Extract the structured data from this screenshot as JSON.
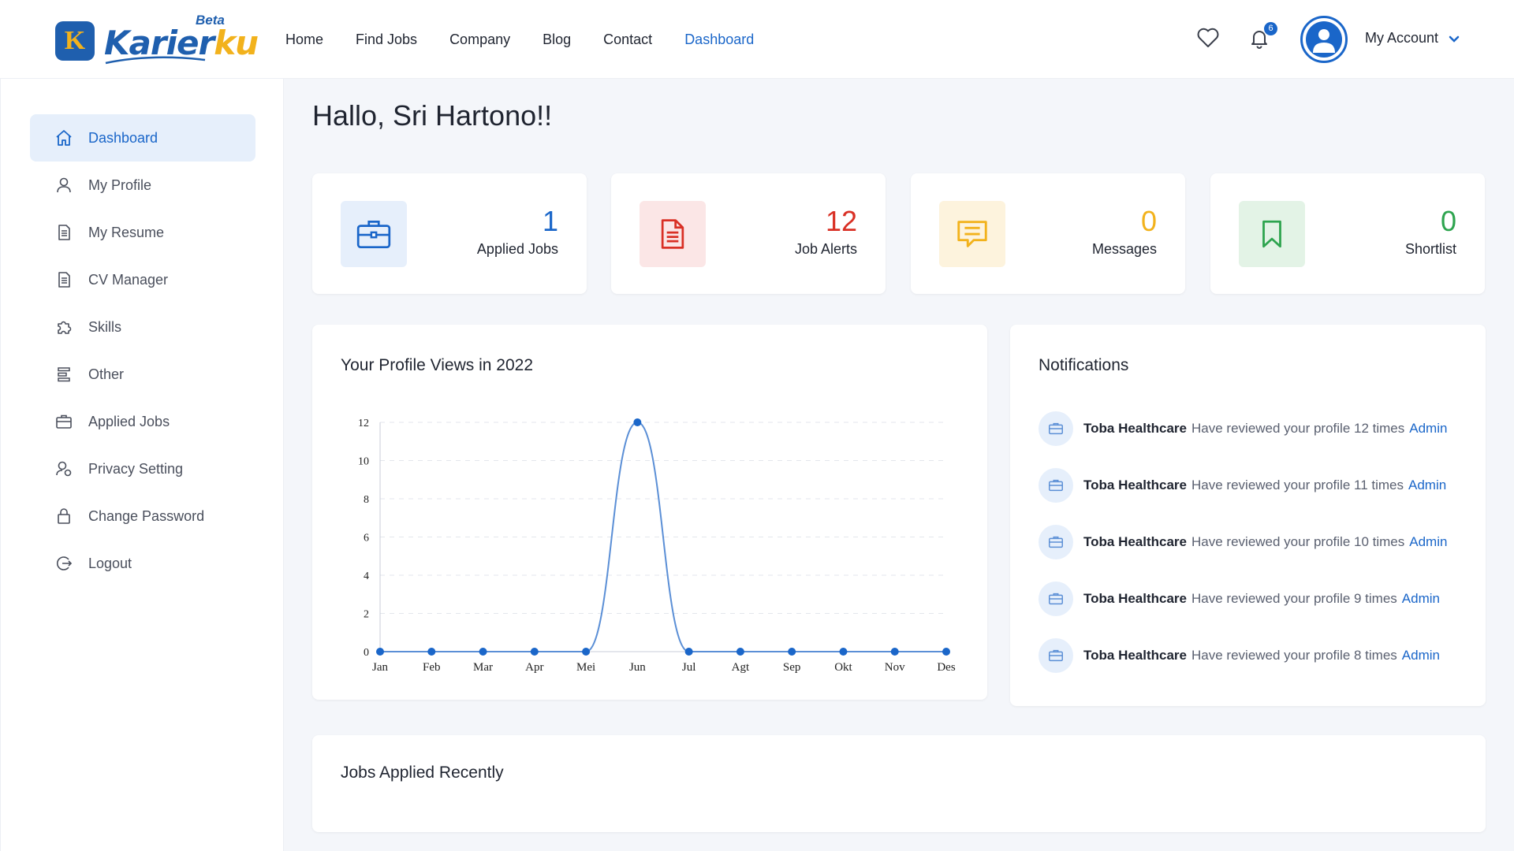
{
  "brand": {
    "name_part1": "Karier",
    "name_part2": "ku",
    "badge": "Beta",
    "logo_letter": "K"
  },
  "nav": [
    {
      "label": "Home",
      "active": false
    },
    {
      "label": "Find Jobs",
      "active": false
    },
    {
      "label": "Company",
      "active": false
    },
    {
      "label": "Blog",
      "active": false
    },
    {
      "label": "Contact",
      "active": false
    },
    {
      "label": "Dashboard",
      "active": true
    }
  ],
  "header": {
    "notification_count": "6",
    "account_label": "My Account"
  },
  "sidebar": {
    "items": [
      {
        "label": "Dashboard",
        "icon": "home-icon",
        "active": true
      },
      {
        "label": "My Profile",
        "icon": "user-icon",
        "active": false
      },
      {
        "label": "My Resume",
        "icon": "document-icon",
        "active": false
      },
      {
        "label": "CV Manager",
        "icon": "document-icon",
        "active": false
      },
      {
        "label": "Skills",
        "icon": "puzzle-icon",
        "active": false
      },
      {
        "label": "Other",
        "icon": "list-icon",
        "active": false
      },
      {
        "label": "Applied Jobs",
        "icon": "briefcase-icon",
        "active": false
      },
      {
        "label": "Privacy Setting",
        "icon": "user-settings-icon",
        "active": false
      },
      {
        "label": "Change Password",
        "icon": "lock-icon",
        "active": false
      },
      {
        "label": "Logout",
        "icon": "logout-icon",
        "active": false
      }
    ]
  },
  "main": {
    "greeting": "Hallo, Sri Hartono!!",
    "stats": [
      {
        "value": "1",
        "label": "Applied Jobs",
        "color": "#1a66c9",
        "bg": "#e6effb",
        "icon": "briefcase-icon"
      },
      {
        "value": "12",
        "label": "Job Alerts",
        "color": "#d93025",
        "bg": "#fbe6e6",
        "icon": "document-icon"
      },
      {
        "value": "0",
        "label": "Messages",
        "color": "#f2b21c",
        "bg": "#fdf3dd",
        "icon": "message-icon"
      },
      {
        "value": "0",
        "label": "Shortlist",
        "color": "#2ea44f",
        "bg": "#e3f3e6",
        "icon": "bookmark-icon"
      }
    ],
    "profile_views_title": "Your Profile Views in 2022",
    "notifications_title": "Notifications",
    "notifications": [
      {
        "company": "Toba Healthcare",
        "message": "Have reviewed your profile 12 times",
        "link": "Admin"
      },
      {
        "company": "Toba Healthcare",
        "message": "Have reviewed your profile 11 times",
        "link": "Admin"
      },
      {
        "company": "Toba Healthcare",
        "message": "Have reviewed your profile 10 times",
        "link": "Admin"
      },
      {
        "company": "Toba Healthcare",
        "message": "Have reviewed your profile 9 times",
        "link": "Admin"
      },
      {
        "company": "Toba Healthcare",
        "message": "Have reviewed your profile 8 times",
        "link": "Admin"
      }
    ],
    "recent_jobs_title": "Jobs Applied Recently"
  },
  "chart_data": {
    "type": "line",
    "title": "Your Profile Views in 2022",
    "categories": [
      "Jan",
      "Feb",
      "Mar",
      "Apr",
      "Mei",
      "Jun",
      "Jul",
      "Agt",
      "Sep",
      "Okt",
      "Nov",
      "Des"
    ],
    "series": [
      {
        "values": [
          0,
          0,
          0,
          0,
          0,
          12,
          0,
          0,
          0,
          0,
          0,
          0
        ],
        "color": "#5b8fd6"
      }
    ],
    "yticks": [
      0,
      2,
      4,
      6,
      8,
      10,
      12
    ],
    "ylim": [
      0,
      12
    ],
    "grid": true,
    "smooth": true
  }
}
